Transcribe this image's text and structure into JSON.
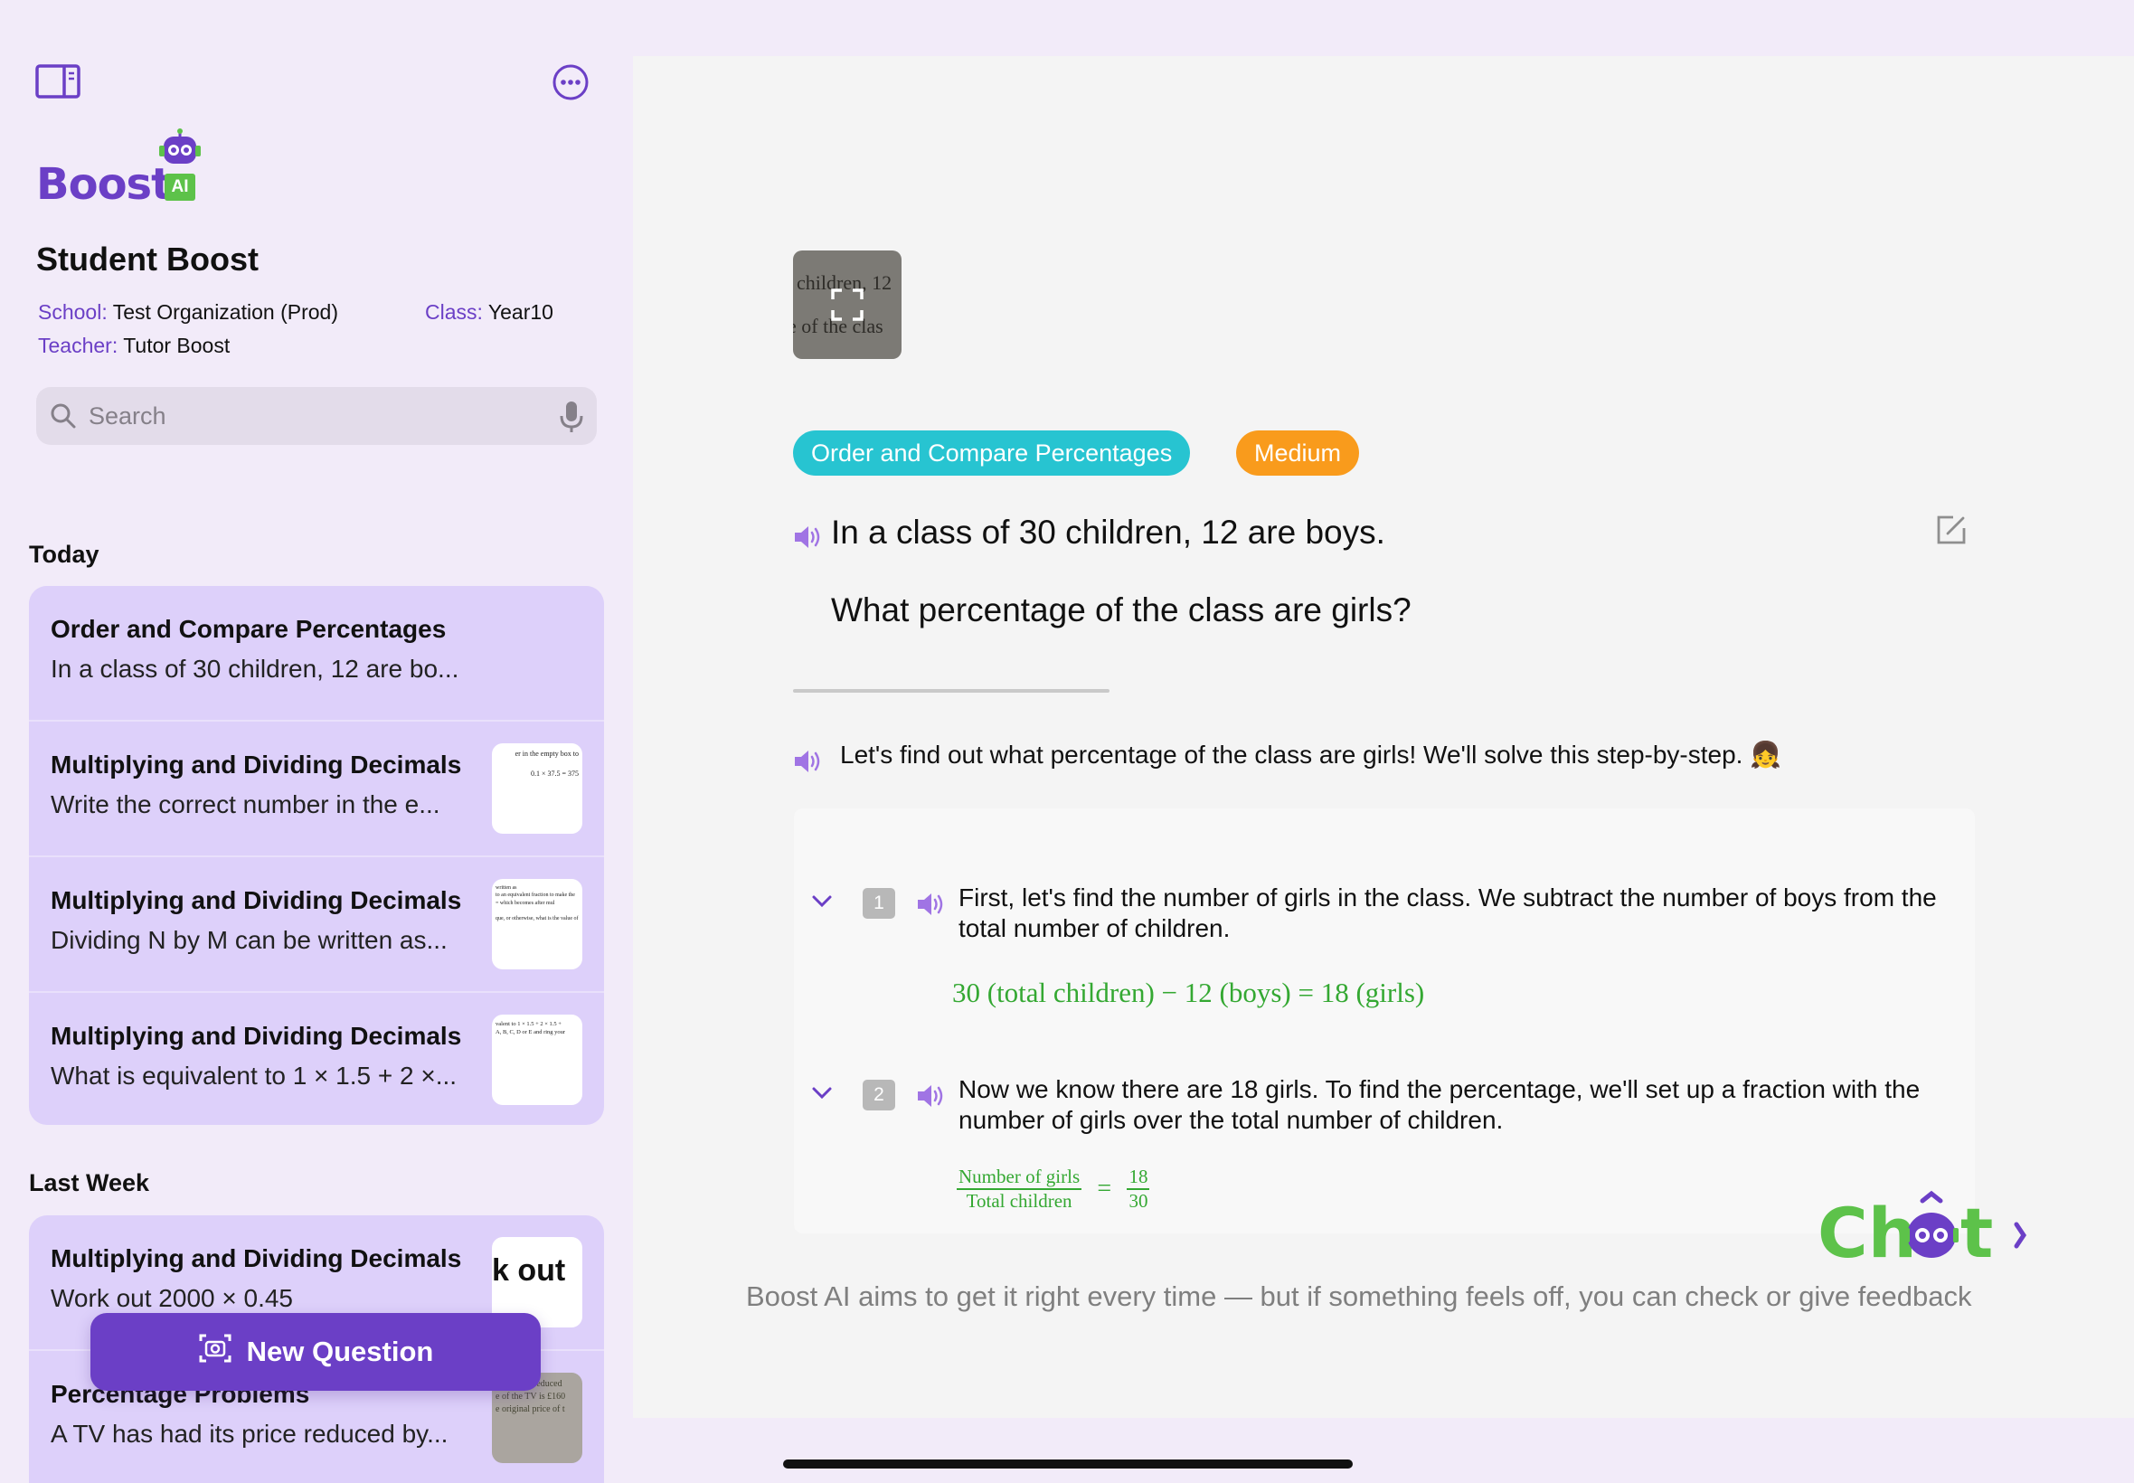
{
  "app": {
    "logo_text": "Boost",
    "logo_badge": "AI"
  },
  "profile": {
    "name": "Student Boost",
    "school_label": "School:",
    "school": "Test Organization (Prod)",
    "class_label": "Class:",
    "class": "Year10",
    "teacher_label": "Teacher:",
    "teacher": "Tutor Boost"
  },
  "search": {
    "placeholder": "Search"
  },
  "history": {
    "today_label": "Today",
    "last_week_label": "Last Week",
    "today": [
      {
        "title": "Order and Compare Percentages",
        "subtitle": "In a class of 30 children, 12 are bo..."
      },
      {
        "title": "Multiplying and Dividing Decimals",
        "subtitle": "Write the correct number in the e...",
        "thumb_text": "er in the empty box to\n\n0.1 × 37.5 = 375"
      },
      {
        "title": "Multiplying and Dividing Decimals",
        "subtitle": "Dividing N by M can be written as...",
        "thumb_text": "written as\nto an equivalent fraction to make the\n= which becomes after mul\n\nque, or otherwise, what is the value of"
      },
      {
        "title": "Multiplying and Dividing Decimals",
        "subtitle": "What is equivalent to 1 × 1.5 + 2 ×...",
        "thumb_text": "valent to 1 × 1.5 + 2 × 1.5 +\nA, B, C, D or E and ring your"
      }
    ],
    "last_week": [
      {
        "title": "Multiplying and Dividing Decimals",
        "subtitle": "Work out 2000 × 0.45",
        "thumb_text": "k out"
      },
      {
        "title": "Percentage Problems",
        "subtitle": "A TV has had its price reduced by...",
        "thumb_text": "d its price reduced\ne of the TV is £160\ne original price of t"
      }
    ]
  },
  "new_question_label": "New Question",
  "question": {
    "image_text_line1": "children, 12",
    "image_text_line2": "e of the clas",
    "topic_tag": "Order and Compare Percentages",
    "difficulty_tag": "Medium",
    "line1": "In a class of 30 children, 12 are boys.",
    "line2": "What percentage of the class are girls?"
  },
  "solution": {
    "intro": "Let's find out what percentage of the class are girls! We'll solve this step-by-step. 👧",
    "steps": [
      {
        "number": "1",
        "text": "First, let's find the number of girls in the class. We subtract the number of boys from the total number of children.",
        "math": "30 (total children) − 12 (boys) = 18 (girls)"
      },
      {
        "number": "2",
        "text": "Now we know there are 18 girls. To find the percentage, we'll set up a fraction with the number of girls over the total number of children.",
        "frac_left_num": "Number of girls",
        "frac_left_den": "Total children",
        "frac_right_num": "18",
        "frac_right_den": "30"
      }
    ]
  },
  "chat_label": "Chat",
  "disclaimer": "Boost AI aims to get it right every time — but if something feels off, you can check or give feedback",
  "colors": {
    "brand_purple": "#6b3fc6",
    "sidebar_card": "#ddd0fa",
    "topic_tag": "#27c4d1",
    "difficulty_tag": "#f99b1c",
    "math_green": "#34a832",
    "logo_green": "#5dc24a"
  }
}
